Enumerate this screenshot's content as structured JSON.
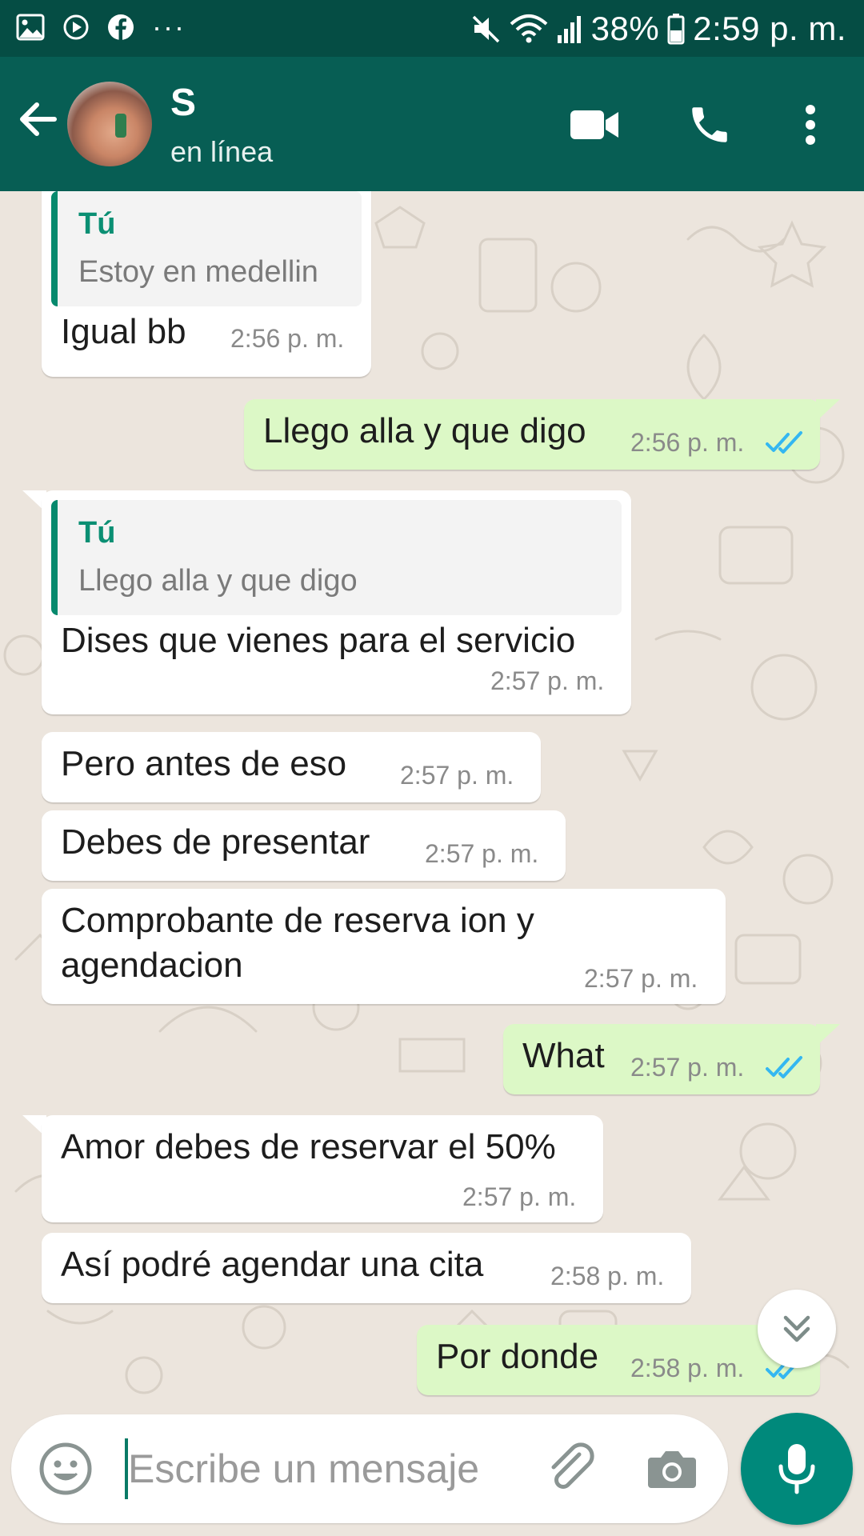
{
  "status_bar": {
    "battery": "38%",
    "time": "2:59 p. m.",
    "more": "···",
    "icons_left": [
      "gallery-icon",
      "play-icon",
      "facebook-icon"
    ],
    "icons_right": [
      "mute-icon",
      "wifi-icon",
      "signal-icon",
      "battery-icon"
    ]
  },
  "header": {
    "contact_name": "S",
    "status": "en línea",
    "actions": [
      "video-call-icon",
      "phone-icon",
      "more-vert-icon"
    ]
  },
  "messages": [
    {
      "dir": "in",
      "quote": {
        "author": "Tú",
        "text": "Estoy en medellin"
      },
      "text": "Igual bb",
      "time": "2:56 p. m."
    },
    {
      "dir": "out",
      "text": "Llego alla y que digo",
      "time": "2:56 p. m.",
      "status": "read"
    },
    {
      "dir": "in",
      "quote": {
        "author": "Tú",
        "text": "Llego alla y que digo"
      },
      "text": "Dises que vienes para el servicio",
      "time": "2:57 p. m."
    },
    {
      "dir": "in",
      "text": "Pero antes de eso",
      "time": "2:57 p. m."
    },
    {
      "dir": "in",
      "text": "Debes de presentar",
      "time": "2:57 p. m."
    },
    {
      "dir": "in",
      "text_line1": "Comprobante de reserva ion y",
      "text_line2": "agendacion",
      "time": "2:57 p. m."
    },
    {
      "dir": "out",
      "text": "What",
      "time": "2:57 p. m.",
      "status": "read"
    },
    {
      "dir": "in",
      "text": "Amor debes de reservar el 50%",
      "time": "2:57 p. m."
    },
    {
      "dir": "in",
      "text": "Así podré agendar una cita",
      "time": "2:58 p. m."
    },
    {
      "dir": "out",
      "text": "Por donde",
      "time": "2:58 p. m.",
      "status": "read"
    }
  ],
  "composer": {
    "placeholder": "Escribe un mensaje",
    "icons": [
      "emoji-icon",
      "attach-icon",
      "camera-icon",
      "mic-icon"
    ]
  },
  "colors": {
    "status_bar": "#054d44",
    "app_bar": "#075e54",
    "outgoing_bubble": "#dcf8c6",
    "incoming_bubble": "#ffffff",
    "chat_background": "#ece5dd",
    "read_ticks": "#34b7f1",
    "quote_accent": "#06896d",
    "mic_button": "#00897b"
  }
}
